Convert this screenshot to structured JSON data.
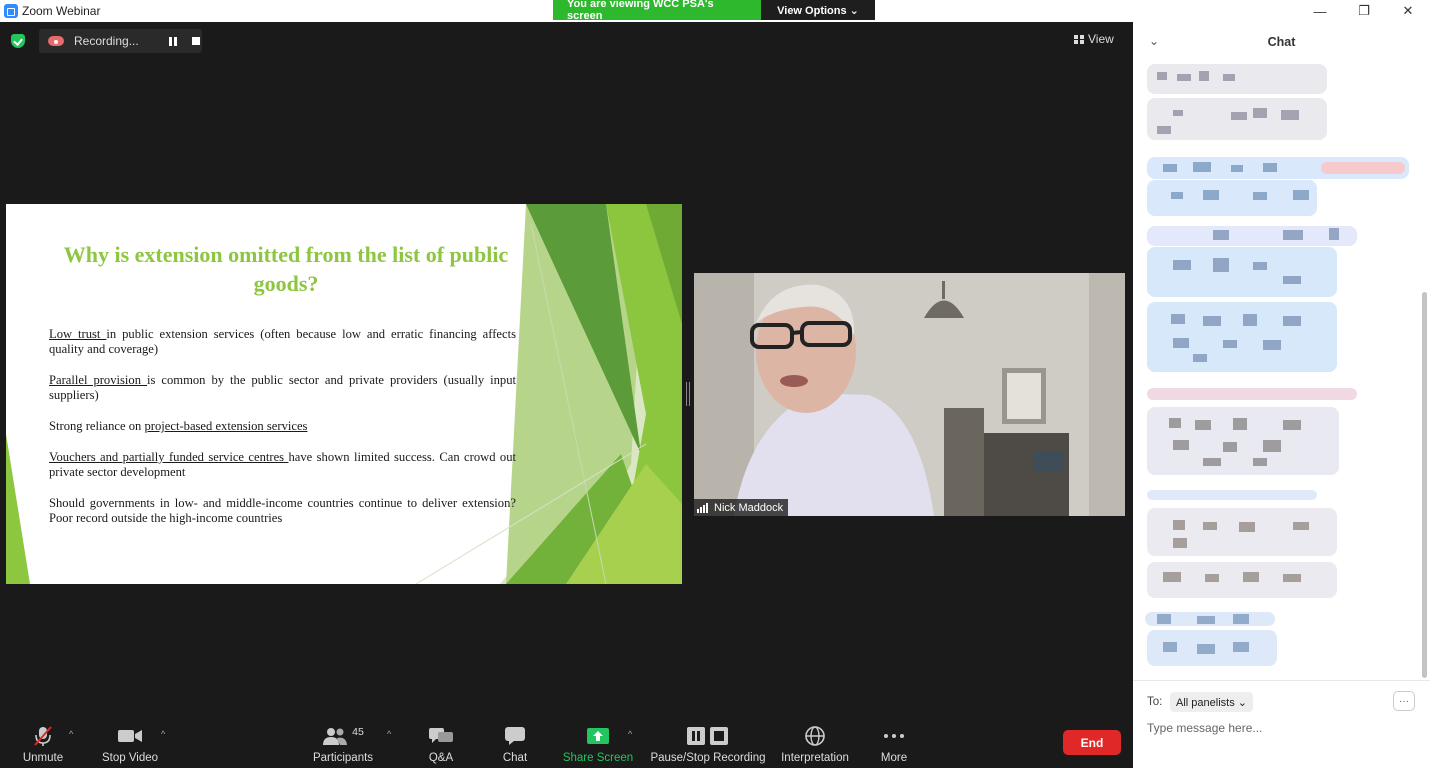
{
  "window": {
    "title": "Zoom Webinar",
    "minimize": "—",
    "maximize": "❐",
    "close": "✕"
  },
  "share_banner": {
    "viewing_text": "You are viewing WCC PSA's screen",
    "view_options": "View Options ⌄"
  },
  "recording": {
    "status": "Recording..."
  },
  "view_button": "View",
  "slide": {
    "title": "Why is extension omitted from the list of public goods?",
    "bullets": [
      {
        "u": "Low trust ",
        "rest": "in public extension services (often because low and erratic financing affects quality and coverage)"
      },
      {
        "u": "Parallel provision ",
        "rest": "is common by the public sector and private providers (usually input suppliers)"
      },
      {
        "pre": "Strong reliance on ",
        "u": "project-based extension services",
        "rest": ""
      },
      {
        "u": "Vouchers and partially funded service centres ",
        "rest": "have shown limited success. Can crowd out private sector development"
      },
      {
        "pre": "Should governments in low- and middle-income countries continue to deliver extension? Poor record outside the high-income countries",
        "u": "",
        "rest": ""
      }
    ]
  },
  "video": {
    "participant_name": "Nick Maddock"
  },
  "toolbar": {
    "unmute": "Unmute",
    "stop_video": "Stop Video",
    "participants": "Participants",
    "participant_count": "45",
    "qa": "Q&A",
    "chat": "Chat",
    "share_screen": "Share Screen",
    "pause_stop_recording": "Pause/Stop Recording",
    "interpretation": "Interpretation",
    "more": "More",
    "end": "End"
  },
  "chat": {
    "title": "Chat",
    "to_label": "To:",
    "to_value": "All panelists ⌄",
    "more": "···",
    "placeholder": "Type message here..."
  },
  "colors": {
    "accent_green": "#2eb82e",
    "slide_title_green": "#8dc63f",
    "end_red": "#e02828",
    "share_green": "#22c55e"
  }
}
